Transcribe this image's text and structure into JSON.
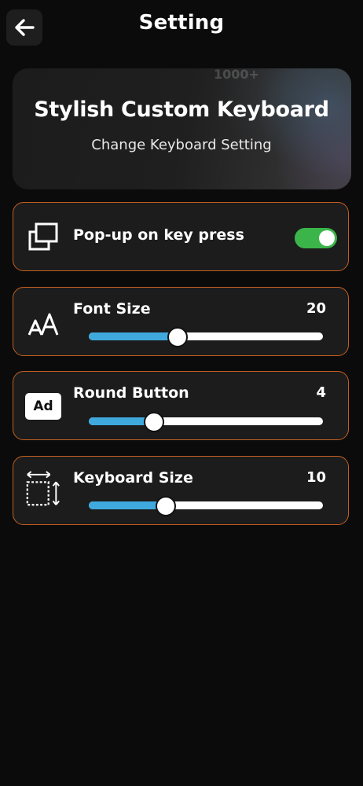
{
  "header": {
    "title": "Setting",
    "back_icon": "arrow-left-icon"
  },
  "banner": {
    "title": "Stylish Custom Keyboard",
    "subtitle": "Change Keyboard Setting",
    "watermark": "1000+"
  },
  "settings": {
    "popup": {
      "label": "Pop-up on key press",
      "icon": "copy-windows-icon",
      "enabled": true
    },
    "font_size": {
      "label": "Font Size",
      "icon": "font-size-icon",
      "value": "20",
      "position": 0.38
    },
    "round_button": {
      "label": "Round Button",
      "icon": "ad-badge-icon",
      "icon_text": "Ad",
      "value": "4",
      "position": 0.28
    },
    "keyboard_size": {
      "label": "Keyboard Size",
      "icon": "resize-frame-icon",
      "value": "10",
      "position": 0.33
    }
  },
  "colors": {
    "accent_border": "#c35f21",
    "toggle_on": "#3bb54a",
    "slider_fill": "#3fa9de",
    "background": "#0b0b0b",
    "card": "#1c1c1c"
  }
}
